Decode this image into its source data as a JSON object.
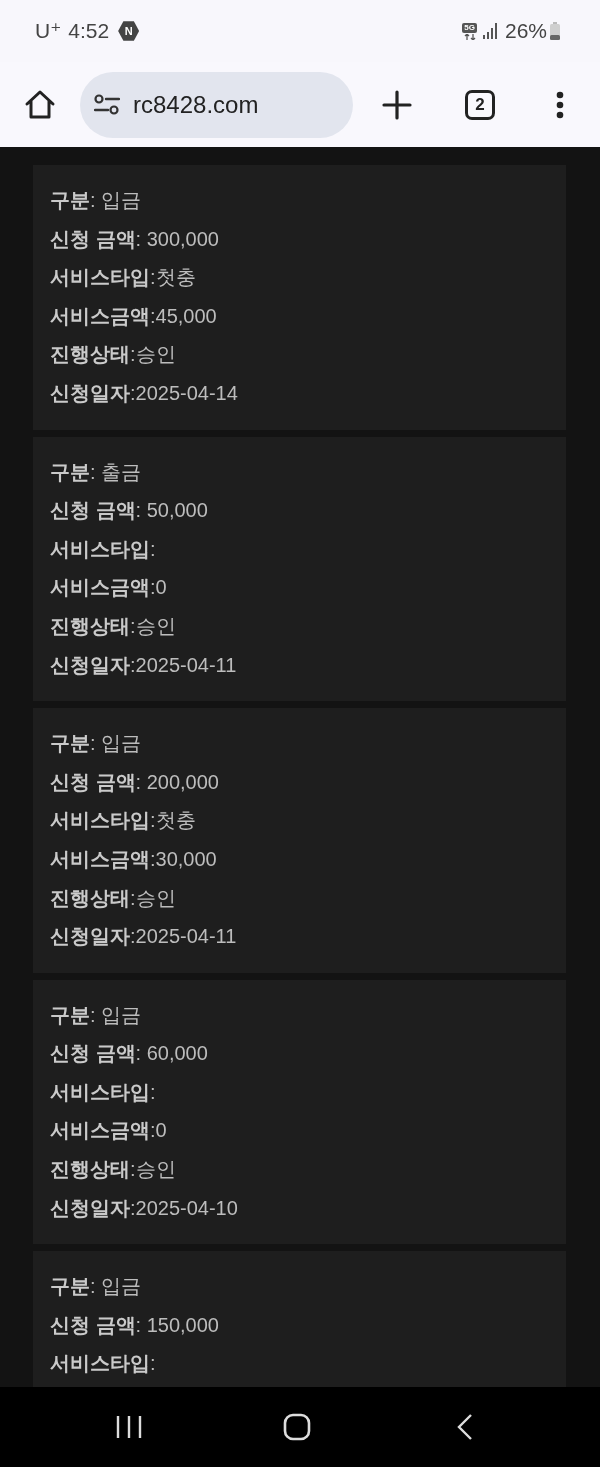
{
  "status_bar": {
    "carrier": "U⁺",
    "time": "4:52",
    "notification_badge": "N",
    "network": "5G",
    "battery": "26%"
  },
  "browser": {
    "url": "rc8428.com",
    "tab_count": "2"
  },
  "records": [
    {
      "lines": [
        "**구분**: 입금",
        "**신청 금액**: 300,000",
        "**서비스타입**:첫충",
        "**서비스금액**:45,000",
        "**진행상태**:승인",
        "**신청일자**:2025-04-14"
      ]
    },
    {
      "lines": [
        "**구분**: 출금",
        "**신청 금액**: 50,000",
        "**서비스타입**:",
        "**서비스금액**:0",
        "**진행상태**:승인",
        "**신청일자**:2025-04-11"
      ]
    },
    {
      "lines": [
        "**구분**: 입금",
        "**신청 금액**: 200,000",
        "**서비스타입**:첫충",
        "**서비스금액**:30,000",
        "**진행상태**:승인",
        "**신청일자**:2025-04-11"
      ]
    },
    {
      "lines": [
        "**구분**: 입금",
        "**신청 금액**: 60,000",
        "**서비스타입**:",
        "**서비스금액**:0",
        "**진행상태**:승인",
        "**신청일자**:2025-04-10"
      ]
    },
    {
      "lines": [
        "**구분**: 입금",
        "**신청 금액**: 150,000",
        "**서비스타입**:"
      ]
    }
  ]
}
